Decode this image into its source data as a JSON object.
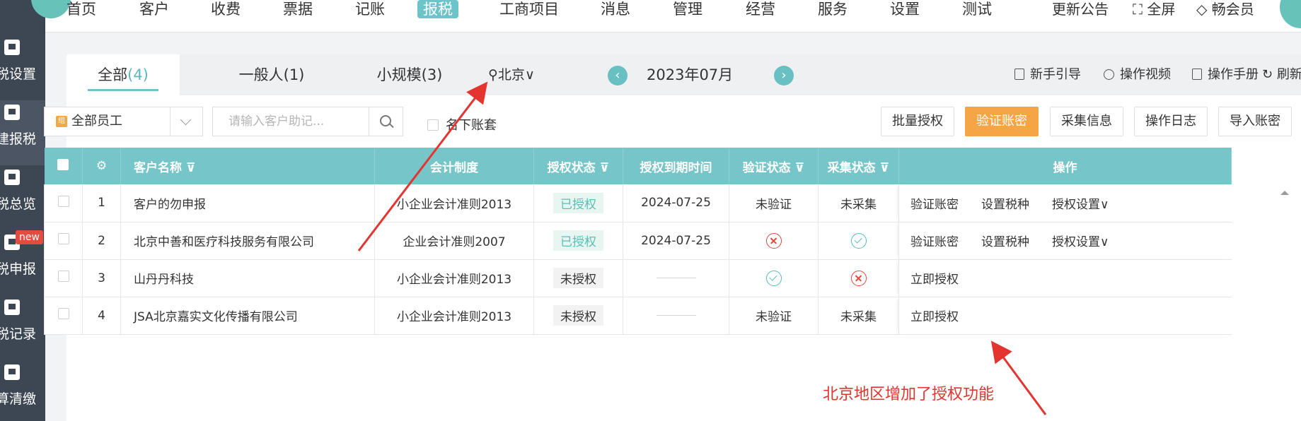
{
  "sidebar": {
    "items": [
      {
        "label": "税设置",
        "icon": "monitor-gear-icon"
      },
      {
        "label": "建报税",
        "icon": "monitor-cursor-icon"
      },
      {
        "label": "税总览",
        "icon": "tax-overview-icon"
      },
      {
        "label": "税申报",
        "icon": "person-yen-icon",
        "badge": "new"
      },
      {
        "label": "税记录",
        "icon": "tax-record-icon"
      },
      {
        "label": "算清缴",
        "icon": "calculator-icon"
      }
    ]
  },
  "topnav": {
    "items": [
      "首页",
      "客户",
      "收费",
      "票据",
      "记账",
      "报税",
      "工商项目",
      "消息",
      "管理",
      "经营",
      "服务",
      "设置",
      "测试"
    ],
    "active": "报税",
    "announcement": "更新公告",
    "fullscreen": "全屏",
    "vip": "畅会员"
  },
  "tabs": {
    "all": {
      "label": "全部",
      "count": "(4)"
    },
    "general": "一般人(1)",
    "small": "小规模(3)",
    "region": "北京"
  },
  "month": {
    "label": "2023年07月",
    "prev": "‹",
    "next": "›"
  },
  "help": {
    "guide": "新手引导",
    "video": "操作视频",
    "manual": "操作手册",
    "refresh": "刷新"
  },
  "filters": {
    "staff": {
      "tag": "组",
      "label": "全部员工"
    },
    "search_placeholder": "请输入客户助记...",
    "own_books": "名下账套"
  },
  "actions": {
    "batch_auth": "批量授权",
    "verify": "验证账密",
    "collect": "采集信息",
    "log": "操作日志",
    "import": "导入账密"
  },
  "table": {
    "headers": {
      "name": "客户名称",
      "system": "会计制度",
      "auth": "授权状态",
      "expire": "授权到期时间",
      "verify": "验证状态",
      "collect": "采集状态",
      "ops": "操作"
    },
    "rows": [
      {
        "index": "1",
        "name": "客户的勿申报",
        "system": "小企业会计准则2013",
        "auth": "已授权",
        "expire": "2024-07-25",
        "verify": "未验证",
        "collect": "未采集",
        "ops": [
          "验证账密",
          "设置税种",
          "授权设置"
        ]
      },
      {
        "index": "2",
        "name": "北京中善和医疗科技服务有限公司",
        "system": "企业会计准则2007",
        "auth": "已授权",
        "expire": "2024-07-25",
        "verify_icon": "fail",
        "collect_icon": "ok",
        "ops": [
          "验证账密",
          "设置税种",
          "授权设置"
        ]
      },
      {
        "index": "3",
        "name": "山丹丹科技",
        "system": "小企业会计准则2013",
        "auth": "未授权",
        "verify_icon": "ok",
        "collect_icon": "fail",
        "ops": [
          "立即授权"
        ]
      },
      {
        "index": "4",
        "name": "JSA北京嘉实文化传播有限公司",
        "system": "小企业会计准则2013",
        "auth": "未授权",
        "verify": "未验证",
        "collect": "未采集",
        "ops": [
          "立即授权"
        ]
      }
    ]
  },
  "annotation": {
    "text": "北京地区增加了授权功能",
    "color": "#e3342f"
  },
  "colors": {
    "accent": "#76c6c9",
    "primary_button": "#f5a446",
    "sidebar_bg": "#3d4754"
  }
}
